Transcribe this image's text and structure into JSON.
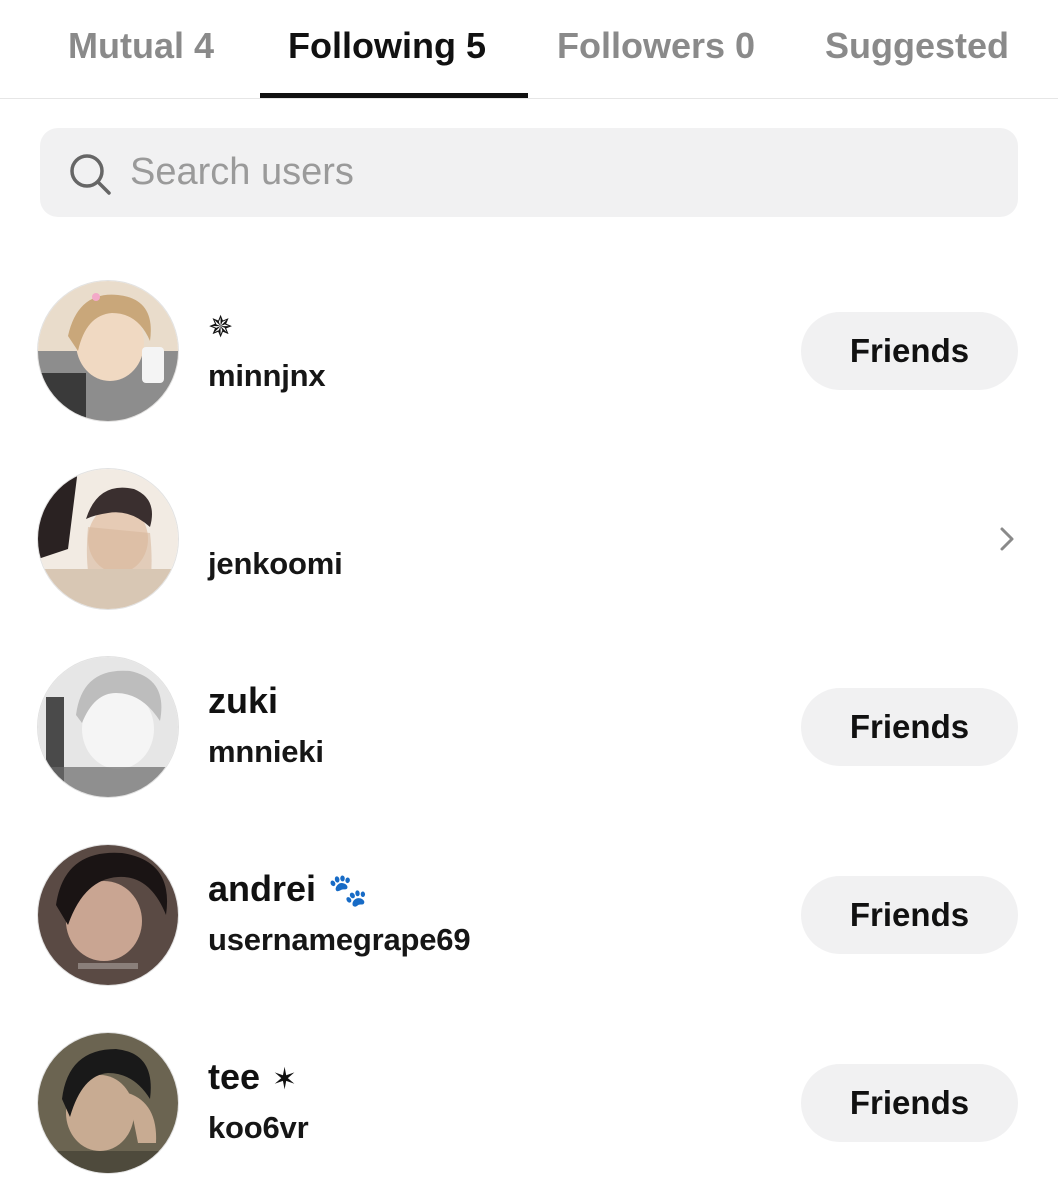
{
  "tabs": [
    {
      "label": "Mutual 4",
      "active": false
    },
    {
      "label": "Following 5",
      "active": true
    },
    {
      "label": "Followers 0",
      "active": false
    },
    {
      "label": "Suggested",
      "active": false
    }
  ],
  "search": {
    "placeholder": "Search users",
    "value": "",
    "icon": "search-icon"
  },
  "button_label": "Friends",
  "users": [
    {
      "display_name": "",
      "display_emoji": "✵",
      "username": "minnjnx",
      "action": "Friends",
      "avatar_colors": [
        "#c9a77a",
        "#e9dccb",
        "#3a3a3a"
      ]
    },
    {
      "display_name": "",
      "display_emoji": "",
      "username": "jenkoomi",
      "action": "chevron-right-icon",
      "avatar_colors": [
        "#d8c7b4",
        "#2a2222",
        "#f2ebe3"
      ]
    },
    {
      "display_name": "zuki",
      "display_emoji": "",
      "username": "mnnieki",
      "action": "Friends",
      "avatar_colors": [
        "#bdbdbd",
        "#e6e6e6",
        "#4a4a4a"
      ]
    },
    {
      "display_name": "andrei",
      "display_emoji": "🐾",
      "username": "usernamegrape69",
      "action": "Friends",
      "avatar_colors": [
        "#5a4a44",
        "#c9a592",
        "#1a1414"
      ]
    },
    {
      "display_name": "tee",
      "display_emoji": "✶",
      "username": "koo6vr",
      "action": "Friends",
      "avatar_colors": [
        "#6b6451",
        "#c8ab92",
        "#191919"
      ]
    }
  ],
  "colors": {
    "text_primary": "#111111",
    "text_inactive": "#8a8a8a",
    "button_bg": "#f1f1f2",
    "search_bg": "#f1f1f2",
    "indicator": "#111111"
  }
}
